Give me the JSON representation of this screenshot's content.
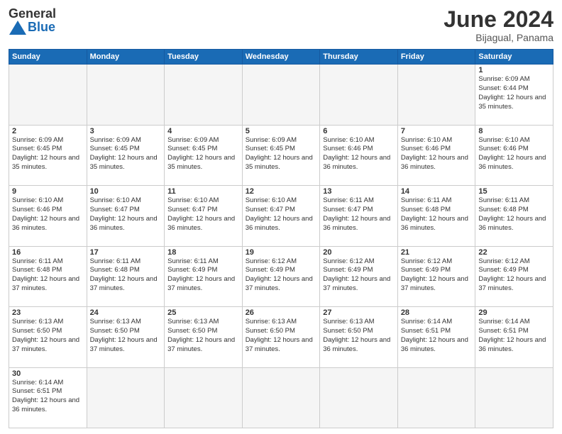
{
  "header": {
    "logo_text_general": "General",
    "logo_text_blue": "Blue",
    "title": "June 2024",
    "location": "Bijagual, Panama"
  },
  "weekdays": [
    "Sunday",
    "Monday",
    "Tuesday",
    "Wednesday",
    "Thursday",
    "Friday",
    "Saturday"
  ],
  "weeks": [
    [
      {
        "day": "",
        "empty": true
      },
      {
        "day": "",
        "empty": true
      },
      {
        "day": "",
        "empty": true
      },
      {
        "day": "",
        "empty": true
      },
      {
        "day": "",
        "empty": true
      },
      {
        "day": "",
        "empty": true
      },
      {
        "day": "1",
        "sunrise": "6:09 AM",
        "sunset": "6:44 PM",
        "daylight": "12 hours and 35 minutes."
      }
    ],
    [
      {
        "day": "2",
        "sunrise": "6:09 AM",
        "sunset": "6:45 PM",
        "daylight": "12 hours and 35 minutes."
      },
      {
        "day": "3",
        "sunrise": "6:09 AM",
        "sunset": "6:45 PM",
        "daylight": "12 hours and 35 minutes."
      },
      {
        "day": "4",
        "sunrise": "6:09 AM",
        "sunset": "6:45 PM",
        "daylight": "12 hours and 35 minutes."
      },
      {
        "day": "5",
        "sunrise": "6:09 AM",
        "sunset": "6:45 PM",
        "daylight": "12 hours and 35 minutes."
      },
      {
        "day": "6",
        "sunrise": "6:10 AM",
        "sunset": "6:46 PM",
        "daylight": "12 hours and 36 minutes."
      },
      {
        "day": "7",
        "sunrise": "6:10 AM",
        "sunset": "6:46 PM",
        "daylight": "12 hours and 36 minutes."
      },
      {
        "day": "8",
        "sunrise": "6:10 AM",
        "sunset": "6:46 PM",
        "daylight": "12 hours and 36 minutes."
      }
    ],
    [
      {
        "day": "9",
        "sunrise": "6:10 AM",
        "sunset": "6:46 PM",
        "daylight": "12 hours and 36 minutes."
      },
      {
        "day": "10",
        "sunrise": "6:10 AM",
        "sunset": "6:47 PM",
        "daylight": "12 hours and 36 minutes."
      },
      {
        "day": "11",
        "sunrise": "6:10 AM",
        "sunset": "6:47 PM",
        "daylight": "12 hours and 36 minutes."
      },
      {
        "day": "12",
        "sunrise": "6:10 AM",
        "sunset": "6:47 PM",
        "daylight": "12 hours and 36 minutes."
      },
      {
        "day": "13",
        "sunrise": "6:11 AM",
        "sunset": "6:47 PM",
        "daylight": "12 hours and 36 minutes."
      },
      {
        "day": "14",
        "sunrise": "6:11 AM",
        "sunset": "6:48 PM",
        "daylight": "12 hours and 36 minutes."
      },
      {
        "day": "15",
        "sunrise": "6:11 AM",
        "sunset": "6:48 PM",
        "daylight": "12 hours and 36 minutes."
      }
    ],
    [
      {
        "day": "16",
        "sunrise": "6:11 AM",
        "sunset": "6:48 PM",
        "daylight": "12 hours and 37 minutes."
      },
      {
        "day": "17",
        "sunrise": "6:11 AM",
        "sunset": "6:48 PM",
        "daylight": "12 hours and 37 minutes."
      },
      {
        "day": "18",
        "sunrise": "6:11 AM",
        "sunset": "6:49 PM",
        "daylight": "12 hours and 37 minutes."
      },
      {
        "day": "19",
        "sunrise": "6:12 AM",
        "sunset": "6:49 PM",
        "daylight": "12 hours and 37 minutes."
      },
      {
        "day": "20",
        "sunrise": "6:12 AM",
        "sunset": "6:49 PM",
        "daylight": "12 hours and 37 minutes."
      },
      {
        "day": "21",
        "sunrise": "6:12 AM",
        "sunset": "6:49 PM",
        "daylight": "12 hours and 37 minutes."
      },
      {
        "day": "22",
        "sunrise": "6:12 AM",
        "sunset": "6:49 PM",
        "daylight": "12 hours and 37 minutes."
      }
    ],
    [
      {
        "day": "23",
        "sunrise": "6:13 AM",
        "sunset": "6:50 PM",
        "daylight": "12 hours and 37 minutes."
      },
      {
        "day": "24",
        "sunrise": "6:13 AM",
        "sunset": "6:50 PM",
        "daylight": "12 hours and 37 minutes."
      },
      {
        "day": "25",
        "sunrise": "6:13 AM",
        "sunset": "6:50 PM",
        "daylight": "12 hours and 37 minutes."
      },
      {
        "day": "26",
        "sunrise": "6:13 AM",
        "sunset": "6:50 PM",
        "daylight": "12 hours and 37 minutes."
      },
      {
        "day": "27",
        "sunrise": "6:13 AM",
        "sunset": "6:50 PM",
        "daylight": "12 hours and 36 minutes."
      },
      {
        "day": "28",
        "sunrise": "6:14 AM",
        "sunset": "6:51 PM",
        "daylight": "12 hours and 36 minutes."
      },
      {
        "day": "29",
        "sunrise": "6:14 AM",
        "sunset": "6:51 PM",
        "daylight": "12 hours and 36 minutes."
      }
    ],
    [
      {
        "day": "30",
        "sunrise": "6:14 AM",
        "sunset": "6:51 PM",
        "daylight": "12 hours and 36 minutes."
      },
      {
        "day": "",
        "empty": true
      },
      {
        "day": "",
        "empty": true
      },
      {
        "day": "",
        "empty": true
      },
      {
        "day": "",
        "empty": true
      },
      {
        "day": "",
        "empty": true
      },
      {
        "day": "",
        "empty": true
      }
    ]
  ]
}
